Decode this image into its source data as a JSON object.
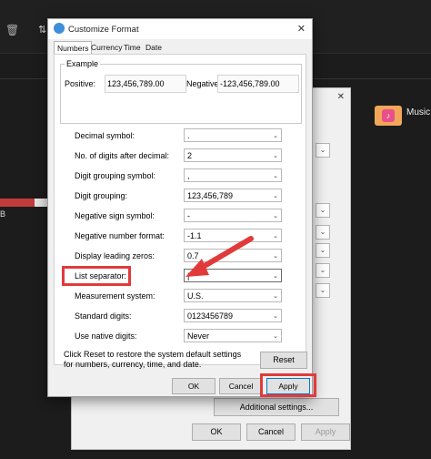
{
  "desktop": {
    "music_label": "Music",
    "edge_text": "B"
  },
  "background_dialog": {
    "additional_settings": "Additional settings...",
    "ok": "OK",
    "cancel": "Cancel",
    "apply": "Apply"
  },
  "dialog": {
    "title": "Customize Format",
    "tabs": [
      "Numbers",
      "Currency",
      "Time",
      "Date"
    ],
    "example": {
      "legend": "Example",
      "positive_label": "Positive:",
      "positive_value": "123,456,789.00",
      "negative_label": "Negative:",
      "negative_value": "-123,456,789.00"
    },
    "fields": [
      {
        "label": "Decimal symbol:",
        "value": "."
      },
      {
        "label": "No. of digits after decimal:",
        "value": "2"
      },
      {
        "label": "Digit grouping symbol:",
        "value": ","
      },
      {
        "label": "Digit grouping:",
        "value": "123,456,789"
      },
      {
        "label": "Negative sign symbol:",
        "value": "-"
      },
      {
        "label": "Negative number format:",
        "value": "-1.1"
      },
      {
        "label": "Display leading zeros:",
        "value": "0.7"
      },
      {
        "label": "List separator:",
        "value": "|"
      },
      {
        "label": "Measurement system:",
        "value": "U.S."
      },
      {
        "label": "Standard digits:",
        "value": "0123456789"
      },
      {
        "label": "Use native digits:",
        "value": "Never"
      }
    ],
    "reset_text": "Click Reset to restore the system default settings for numbers, currency, time, and date.",
    "reset_button": "Reset",
    "ok": "OK",
    "cancel": "Cancel",
    "apply": "Apply"
  },
  "colors": {
    "annotation": "#e23a3a",
    "accent": "#0078d4"
  }
}
